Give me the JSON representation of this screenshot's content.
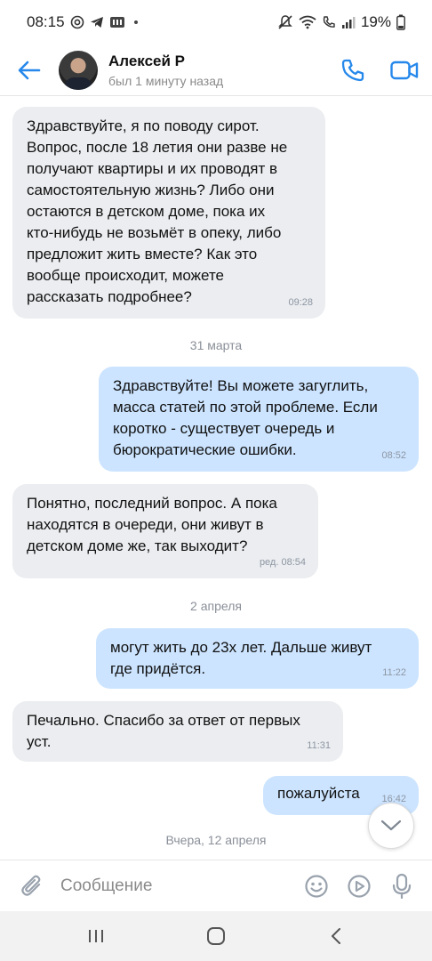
{
  "status_bar": {
    "time": "08:15",
    "battery": "19%"
  },
  "header": {
    "contact_name": "Алексей Р",
    "contact_status": "был 1 минуту назад"
  },
  "messages": [
    {
      "direction": "in",
      "text": "Здравствуйте, я по поводу сирот.\nВопрос, после 18 летия они разве не\nполучают квартиры и их проводят в\nсамостоятельную жизнь? Либо они\nостаются в детском доме, пока их\nкто-нибудь не возьмёт в опеку, либо\nпредложит жить вместе? Как это\nвообще происходит, можете\nрассказать подробнее?",
      "time": "09:28"
    },
    {
      "direction": "out",
      "text": "Здравствуйте! Вы можете загуглить,\nмасса статей по этой проблеме. Если\nкоротко - существует очередь и\nбюрократические ошибки.",
      "time": "08:52"
    },
    {
      "direction": "in",
      "text": "Понятно, последний вопрос. А пока\nнаходятся в очереди, они живут в\nдетском доме же, так выходит?",
      "time": "ред. 08:54"
    },
    {
      "direction": "out",
      "text": "могут жить до 23х лет. Дальше живут\nгде придётся.",
      "time": "11:22"
    },
    {
      "direction": "in",
      "text": "Печально. Спасибо за ответ от первых\nуст.",
      "time": "11:31"
    },
    {
      "direction": "out",
      "text": "пожалуйста",
      "time": "16:42"
    }
  ],
  "date_separators": [
    "31 марта",
    "2 апреля",
    "Вчера, 12 апреля"
  ],
  "composer": {
    "placeholder": "Сообщение"
  },
  "colors": {
    "accent": "#2688eb",
    "incoming_bubble": "#ebedf0",
    "outgoing_bubble": "#cce4ff"
  }
}
